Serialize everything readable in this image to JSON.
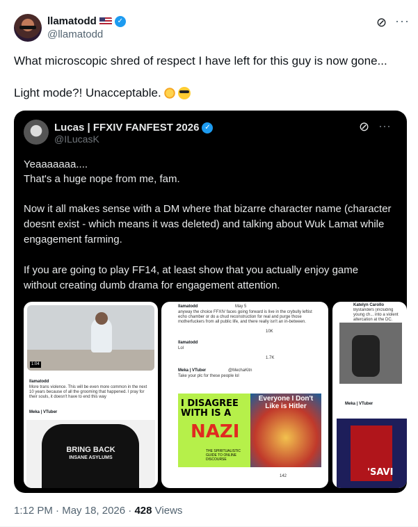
{
  "author": {
    "name": "llamatodd",
    "handle": "@llamatodd"
  },
  "tweet": {
    "line1": "What microscopic shred of respect I have left for this guy is now gone...",
    "line2": "Light mode?! Unacceptable."
  },
  "quoted": {
    "name": "Lucas | FFXIV FANFEST 2026",
    "handle": "@ILucasK",
    "p1": "Yeaaaaaaa....",
    "p2": "That's a huge nope from me, fam.",
    "p3": "Now it all makes sense with a DM where that bizarre character name (character doesnt exist - which means it was deleted) and talking about Wuk Lamat while engagement farming.",
    "p4": "If you are going to play FF14, at least show that you actually enjoy game without creating dumb drama for engagement attention.",
    "img1": {
      "video_time": "1:04",
      "author": "llamatodd",
      "text": "More trans violence. This will be even more common in the next 10 years because of all the grooming that happened. I pray for their souls, it doesn't have to end this way",
      "author2": "Meka | VTuber",
      "shirt_line1": "BRING BACK",
      "shirt_line2": "INSANE ASYLUMS"
    },
    "img2": {
      "author": "llamatodd",
      "date": "May 5",
      "text1": "anyway the choice FFXIV faces going forward is live in the crybully leftist echo chamber or do a chud reconstruction for real and purge those motherfuckers from all public life, and there really isn't an in-between.",
      "text2": "Lol",
      "author3": "Meka | VTuber",
      "handle3": "@MechaKitn",
      "text3": "Take your plc for these people lol",
      "poster_left": "I DISAGREE WITH IS A",
      "poster_nazi": "NAZI",
      "poster_right": "Everyone I Don't Like is Hitler",
      "poster_sub": "THE SPIRITUALISTIC GUIDE TO ONLINE DISCOURSE",
      "views1": "10K",
      "views2": "1.7K",
      "views3": "142"
    },
    "img3": {
      "author": "Katelyn Carollo",
      "text": "Bystanders (including young ch... into a violent altercation at the DC.",
      "author2": "Meka | VTuber",
      "poster_word": "'SAVI"
    }
  },
  "footer": {
    "time": "1:12 PM",
    "date": "May 18, 2026",
    "views_count": "428",
    "views_label": "Views"
  },
  "icons": {
    "verified": "verified-badge-icon",
    "grok": "grok-icon",
    "more": "more-icon"
  },
  "colors": {
    "accent": "#1d9bf0",
    "quote_bg": "#000000"
  }
}
